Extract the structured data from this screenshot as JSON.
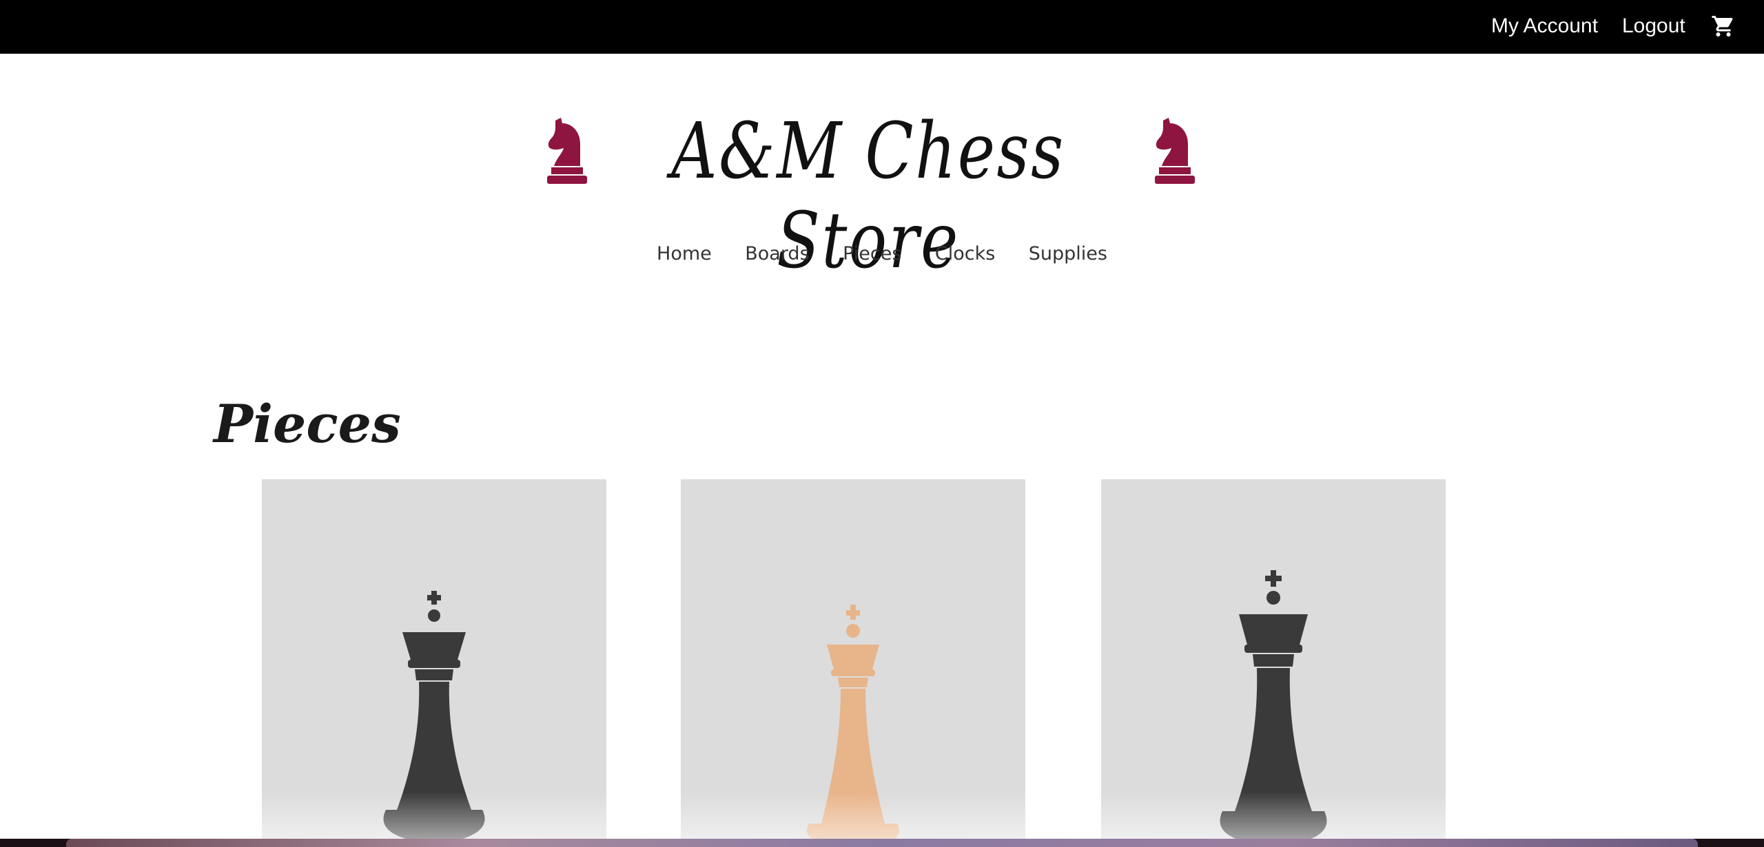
{
  "topbar": {
    "account_label": "My Account",
    "logout_label": "Logout",
    "cart_icon": "shopping-cart-icon"
  },
  "brand": {
    "title": "A&M Chess Store",
    "icon": "chess-knight-icon",
    "accent_color": "#8e1540"
  },
  "nav": {
    "items": [
      "Home",
      "Boards",
      "Pieces",
      "Clocks",
      "Supplies"
    ]
  },
  "section": {
    "title": "Pieces"
  },
  "products": [
    {
      "image": "black-king-piece",
      "color": "#3a3a3a"
    },
    {
      "image": "wooden-king-piece",
      "color": "#e8b48a"
    },
    {
      "image": "black-king-piece",
      "color": "#3a3a3a"
    }
  ]
}
